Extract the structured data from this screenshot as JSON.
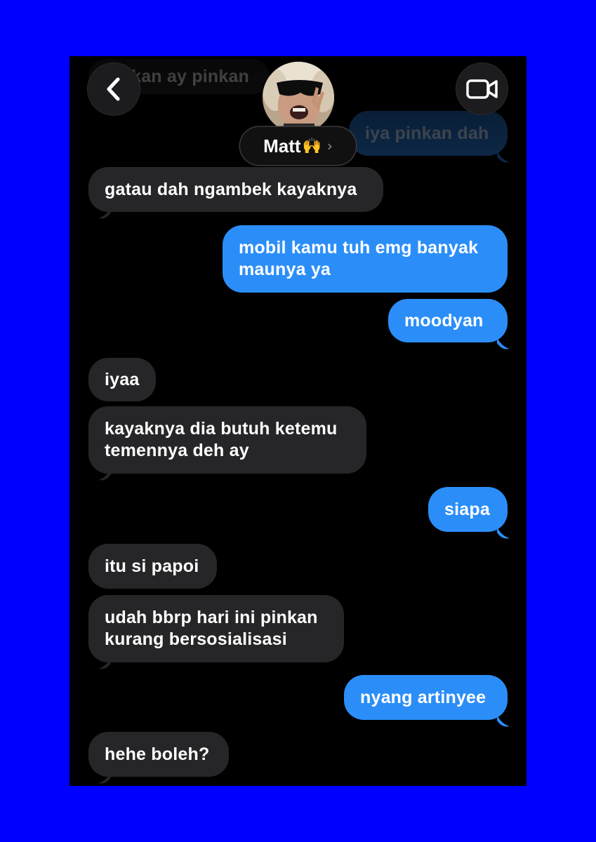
{
  "header": {
    "contact_name": "Matt",
    "contact_emoji": "🙌",
    "chevron": "›",
    "back_icon": "chevron-left-icon",
    "video_icon": "video-camera-icon"
  },
  "messages": [
    {
      "direction": "incoming",
      "text": "pinkan ay pinkan",
      "faded": true
    },
    {
      "direction": "outgoing",
      "text": "iya pinkan dah",
      "faded": true
    },
    {
      "direction": "incoming",
      "text": "gatau dah ngambek kayaknya"
    },
    {
      "direction": "outgoing",
      "text": "mobil kamu tuh emg banyak\nmaunya ya"
    },
    {
      "direction": "outgoing",
      "text": "moodyan"
    },
    {
      "direction": "incoming",
      "text": "iyaa"
    },
    {
      "direction": "incoming",
      "text": "kayaknya dia butuh ketemu\ntemennya deh ay"
    },
    {
      "direction": "outgoing",
      "text": "siapa"
    },
    {
      "direction": "incoming",
      "text": "itu si papoi"
    },
    {
      "direction": "incoming",
      "text": "udah bbrp hari ini pinkan\nkurang bersosialisasi"
    },
    {
      "direction": "outgoing",
      "text": "nyang artinyee"
    },
    {
      "direction": "incoming",
      "text": "hehe boleh?"
    }
  ],
  "colors": {
    "background": "#0000ff",
    "screen": "#000000",
    "incoming_bubble": "#262628",
    "outgoing_bubble": "#2b8ef8"
  }
}
